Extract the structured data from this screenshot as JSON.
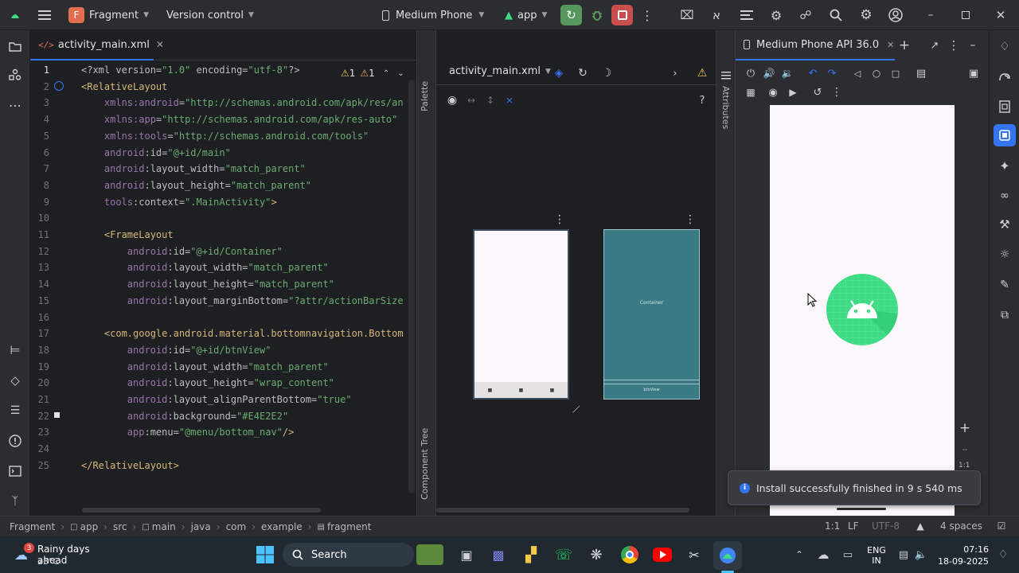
{
  "titlebar": {
    "project_letter": "F",
    "project_name": "Fragment",
    "vcs": "Version control",
    "device": "Medium Phone",
    "run_config": "app"
  },
  "editor": {
    "tab": "activity_main.xml",
    "warnings": "1",
    "weak_warnings": "1",
    "lines": [
      {
        "n": "1",
        "html": "<span class='p'>&lt;?xml version=</span><span class='s'>\"1.0\"</span><span class='p'> encoding=</span><span class='s'>\"utf-8\"</span><span class='p'>?&gt;</span>"
      },
      {
        "n": "2",
        "html": "<span class='t'>&lt;RelativeLayout</span>"
      },
      {
        "n": "3",
        "html": "    <span class='ns'>xmlns:android</span><span class='p'>=</span><span class='s'>\"http://schemas.android.com/apk/res/an</span>"
      },
      {
        "n": "4",
        "html": "    <span class='ns'>xmlns:app</span><span class='p'>=</span><span class='s'>\"http://schemas.android.com/apk/res-auto\"</span>"
      },
      {
        "n": "5",
        "html": "    <span class='ns'>xmlns:tools</span><span class='p'>=</span><span class='s'>\"http://schemas.android.com/tools\"</span>"
      },
      {
        "n": "6",
        "html": "    <span class='ns'>android</span><span class='a'>:id=</span><span class='s'>\"@+id/main\"</span>"
      },
      {
        "n": "7",
        "html": "    <span class='ns'>android</span><span class='a'>:layout_width=</span><span class='s'>\"match_parent\"</span>"
      },
      {
        "n": "8",
        "html": "    <span class='ns'>android</span><span class='a'>:layout_height=</span><span class='s'>\"match_parent\"</span>"
      },
      {
        "n": "9",
        "html": "    <span class='ns'>tools</span><span class='a'>:context=</span><span class='s'>\".MainActivity\"</span><span class='t'>&gt;</span>"
      },
      {
        "n": "10",
        "html": ""
      },
      {
        "n": "11",
        "html": "    <span class='t'>&lt;FrameLayout</span>"
      },
      {
        "n": "12",
        "html": "        <span class='ns'>android</span><span class='a'>:id=</span><span class='s'>\"@+id/Container\"</span>"
      },
      {
        "n": "13",
        "html": "        <span class='ns'>android</span><span class='a'>:layout_width=</span><span class='s'>\"match_parent\"</span>"
      },
      {
        "n": "14",
        "html": "        <span class='ns'>android</span><span class='a'>:layout_height=</span><span class='s'>\"match_parent\"</span>"
      },
      {
        "n": "15",
        "html": "        <span class='ns'>android</span><span class='a'>:layout_marginBottom=</span><span class='s'>\"?attr/actionBarSize</span>"
      },
      {
        "n": "16",
        "html": ""
      },
      {
        "n": "17",
        "html": "    <span class='t'>&lt;com.google.android.material.bottomnavigation.Bottom</span>"
      },
      {
        "n": "18",
        "html": "        <span class='ns'>android</span><span class='a'>:id=</span><span class='s'>\"@+id/btnView\"</span>"
      },
      {
        "n": "19",
        "html": "        <span class='ns'>android</span><span class='a'>:layout_width=</span><span class='s'>\"match_parent\"</span>"
      },
      {
        "n": "20",
        "html": "        <span class='ns'>android</span><span class='a'>:layout_height=</span><span class='s'>\"wrap_content\"</span>"
      },
      {
        "n": "21",
        "html": "        <span class='ns'>android</span><span class='a'>:layout_alignParentBottom=</span><span class='s'>\"true\"</span>"
      },
      {
        "n": "22",
        "html": "        <span class='ns'>android</span><span class='a'>:background=</span><span class='s'>\"#E4E2E2\"</span>"
      },
      {
        "n": "23",
        "html": "        <span class='ns'>app</span><span class='a'>:menu=</span><span class='s'>\"@menu/bottom_nav\"</span><span class='t'>/&gt;</span>"
      },
      {
        "n": "24",
        "html": ""
      },
      {
        "n": "25",
        "html": "<span class='t'>&lt;/RelativeLayout&gt;</span>"
      }
    ]
  },
  "design": {
    "file_dropdown": "activity_main.xml",
    "palette_label": "Palette",
    "component_tree_label": "Component Tree",
    "attributes_label": "Attributes",
    "blueprint_container_label": "Container",
    "blueprint_nav_label": "btnView"
  },
  "running_devices": {
    "tab": "Medium Phone API 36.0",
    "zoom_ratio": "1:1",
    "notification": "Install successfully finished in 9 s 540 ms"
  },
  "statusbar": {
    "breadcrumbs": [
      "Fragment",
      "app",
      "src",
      "main",
      "java",
      "com",
      "example",
      "fragment"
    ],
    "position": "1:1",
    "line_sep": "LF",
    "encoding": "UTF-8",
    "indent": "4 spaces"
  },
  "taskbar": {
    "weather_badge": "3",
    "weather_title": "Rainy days ahead",
    "weather_temp": "23°C",
    "search": "Search",
    "lang1": "ENG",
    "lang2": "IN",
    "time": "07:16",
    "date": "18-09-2025"
  },
  "colors": {
    "accent": "#3574f0",
    "run_green": "#57965c",
    "stop_red": "#c94f4f",
    "android_green": "#3ddc84"
  }
}
